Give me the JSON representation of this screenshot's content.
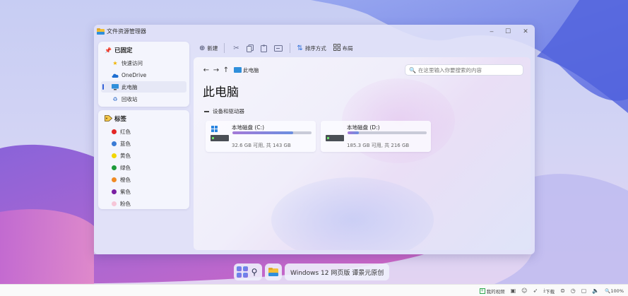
{
  "window": {
    "title": "文件资源管理器",
    "minimize_glyph": "‒",
    "maximize_glyph": "☐",
    "close_glyph": "✕"
  },
  "sidebar": {
    "pinned_header": "已固定",
    "pinned_items": [
      {
        "label": "快速访问",
        "icon": "star-icon"
      },
      {
        "label": "OneDrive",
        "icon": "cloud-icon"
      },
      {
        "label": "此电脑",
        "icon": "computer-icon",
        "active": true
      },
      {
        "label": "回收站",
        "icon": "recycle-bin-icon"
      }
    ],
    "tags_header": "标签",
    "tags": [
      {
        "label": "红色",
        "color": "#e32626"
      },
      {
        "label": "蓝色",
        "color": "#3a7bd5"
      },
      {
        "label": "黄色",
        "color": "#f2d600"
      },
      {
        "label": "绿色",
        "color": "#1d9a3a"
      },
      {
        "label": "橙色",
        "color": "#f08a24"
      },
      {
        "label": "紫色",
        "color": "#7a1fa2"
      },
      {
        "label": "粉色",
        "color": "#f6c6d8"
      }
    ]
  },
  "toolbar": {
    "new_label": "新建",
    "sort_label": "排序方式",
    "layout_label": "布局"
  },
  "address": {
    "crumb": "此电脑"
  },
  "search": {
    "placeholder": "在这里输入你要搜索的内容"
  },
  "main": {
    "title": "此电脑",
    "section_label": "设备和驱动器",
    "drives": [
      {
        "name": "本地磁盘 (C:)",
        "info": "32.6 GB 可用, 共 143 GB",
        "used_fraction": 0.77,
        "system": true
      },
      {
        "name": "本地磁盘 (D:)",
        "info": "185.3 GB 可用, 共 216 GB",
        "used_fraction": 0.14,
        "system": false
      }
    ]
  },
  "taskbar": {
    "label": "Windows 12 网页版 谭景元原创"
  },
  "statusbar": {
    "video_label": "我的视频",
    "download_label": "下载",
    "zoom": "100%"
  }
}
